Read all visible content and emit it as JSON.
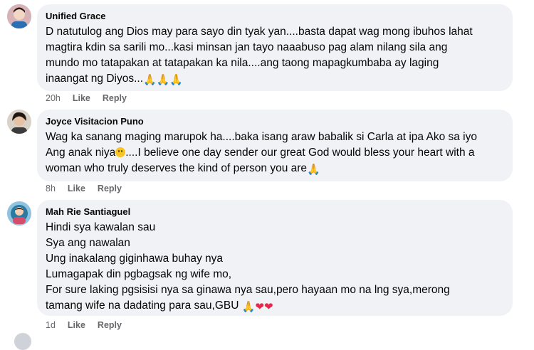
{
  "comments": [
    {
      "author": "Unified Grace",
      "lines": [
        "D natutulog ang Dios may para sayo din tyak yan....basta dapat wag mong ibuhos lahat",
        "magtira kdin sa sarili mo...kasi minsan jan tayo naaabuso pag alam nilang sila ang",
        "mundo mo tatapakan at tatapakan ka nila....ang taong mapagkumbaba ay laging",
        "inaangat ng Diyos..."
      ],
      "time": "20h",
      "like": "Like",
      "reply": "Reply",
      "trailing_emoji": "pray-pray-pray",
      "avatar_icon": "profile-photo-icon"
    },
    {
      "author": "Joyce Visitacion Puno",
      "lines": [
        "Wag ka sanang maging marupok ha....baka isang araw babalik si Carla at ipa Ako sa iyo",
        "Ang anak niya",
        "....I believe one day sender our great God would bless your heart with a",
        "woman who truly deserves the kind of person you are"
      ],
      "time": "8h",
      "like": "Like",
      "reply": "Reply",
      "avatar_icon": "profile-photo-icon"
    },
    {
      "author": "Mah Rie Santiaguel",
      "lines": [
        "Hindi sya kawalan sau",
        "Sya ang nawalan",
        "Ung inakalang giginhawa buhay nya",
        "Lumagapak din pgbagsak ng wife mo,",
        "For sure laking pgsisisi nya sa ginawa nya sau,pero hayaan mo na lng sya,merong",
        "tamang wife na dadating para sau,GBU"
      ],
      "time": "1d",
      "like": "Like",
      "reply": "Reply",
      "avatar_icon": "profile-photo-icon"
    }
  ]
}
